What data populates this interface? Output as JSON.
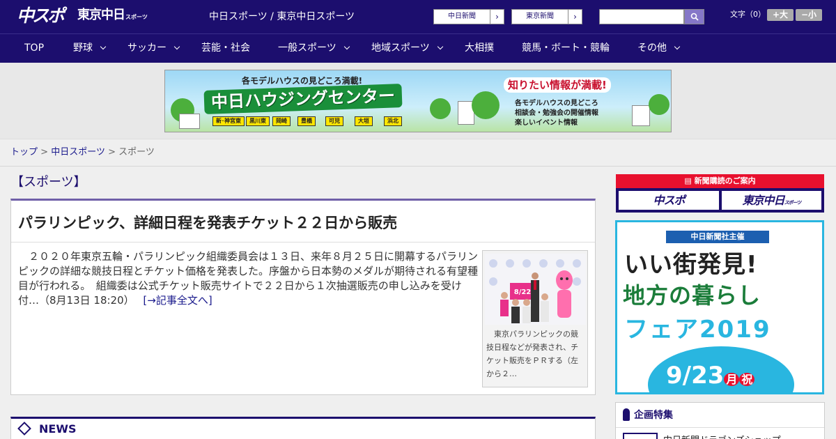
{
  "header": {
    "logo_chuspo": "中スポ",
    "logo_tokyo": "東京中日",
    "logo_tokyo_sub": "スポーツ",
    "site_title": "中日スポーツ / 東京中日スポーツ",
    "btn_chunichi": "中日新聞",
    "btn_tokyo": "東京新聞",
    "arrow": "›",
    "search_placeholder": "",
    "font_size_label": "文字（0）",
    "font_large": "+大",
    "font_small": "−小"
  },
  "nav": {
    "items": [
      {
        "label": "TOP",
        "dropdown": false
      },
      {
        "label": "野球",
        "dropdown": true
      },
      {
        "label": "サッカー",
        "dropdown": true
      },
      {
        "label": "芸能・社会",
        "dropdown": false
      },
      {
        "label": "一般スポーツ",
        "dropdown": true
      },
      {
        "label": "地域スポーツ",
        "dropdown": true
      },
      {
        "label": "大相撲",
        "dropdown": false
      },
      {
        "label": "競馬・ボート・競輪",
        "dropdown": false
      },
      {
        "label": "その他",
        "dropdown": true
      }
    ]
  },
  "banner": {
    "subtitle": "各モデルハウスの見どころ満載!",
    "title": "中日ハウジングセンター",
    "locations": [
      "新･神宮東",
      "黒川東",
      "岡崎",
      "豊橋",
      "可児",
      "大垣",
      "浜北"
    ],
    "right_title": "知りたい情報が満載!",
    "right_items": [
      "各モデルハウスの見どころ",
      "相談会・勉強会の開催情報",
      "楽しいイベント情報"
    ]
  },
  "breadcrumb": {
    "top": "トップ",
    "sep": ">",
    "chunichi": "中日スポーツ",
    "current": "スポーツ"
  },
  "section": {
    "title": "【スポーツ】"
  },
  "article": {
    "title": "パラリンピック、詳細日程を発表チケット２２日から販売",
    "body": "　２０２０年東京五輪・パラリンピック組織委員会は１３日、来年８月２５日に開幕するパラリンピックの詳細な競技日程とチケット価格を発表した。序盤から日本勢のメダルが期待される有望種目が行われる。　組織委は公式チケット販売サイトで２２日から１次抽選販売の申し込みを受け付…（8月13日 18:20）",
    "read_more": "[→記事全文へ]",
    "photo_board_text": "8/22",
    "photo_caption": "　東京パラリンピックの競技日程などが発表され、チケット販売をＰＲする（左から２…"
  },
  "news": {
    "label": "NEWS"
  },
  "sidebar": {
    "subscribe_head": "新聞購読のご案内",
    "subscribe_chuspo": "中スポ",
    "subscribe_tokyo": "東京中日",
    "subscribe_tokyo_sub": "スポーツ",
    "fair_badge": "中日新聞社主催",
    "fair_line1": "いい街発見!",
    "fair_line2": "地方の暮らし",
    "fair_line3": "フェア2019",
    "fair_date": "9/23",
    "fair_date_day": "月",
    "fair_date_holiday": "祝",
    "feature_head": "企画特集",
    "feature_item": "中日新聞ドラゴンズショップ"
  },
  "colors": {
    "header_bg": "#1c0e6e",
    "accent_red": "#d0102e",
    "accent_purple": "#6f5fa8",
    "fair_blue": "#29b6e0"
  }
}
